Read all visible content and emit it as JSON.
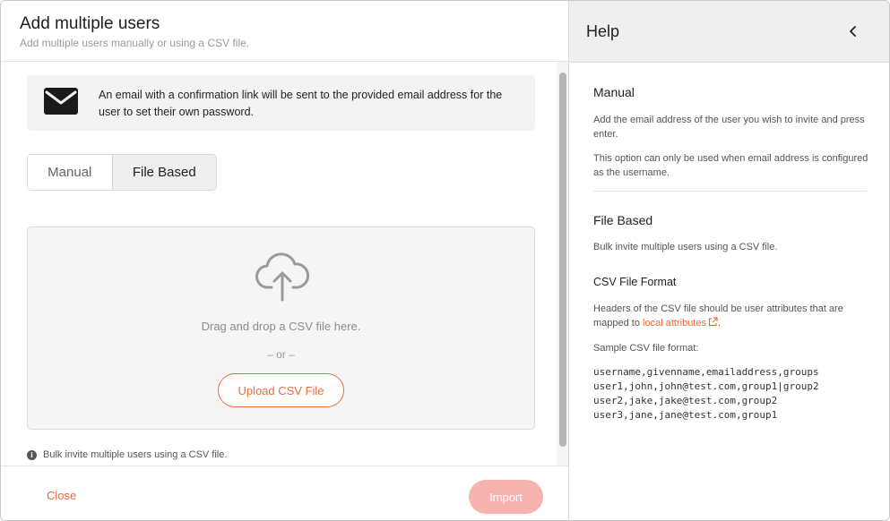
{
  "dialog": {
    "title": "Add multiple users",
    "subtitle": "Add multiple users manually or using a CSV file."
  },
  "info": {
    "icon": "mail-icon",
    "text": "An email with a confirmation link will be sent to the provided email address for the user to set their own password."
  },
  "mode_tabs": {
    "manual_label": "Manual",
    "file_label": "File Based",
    "selected": "File Based"
  },
  "dropzone": {
    "icon": "cloud-upload-icon",
    "text": "Drag and drop a CSV file here.",
    "or_text": "– or –",
    "upload_label": "Upload CSV File"
  },
  "hint": {
    "icon": "info-icon",
    "text": "Bulk invite multiple users using a CSV file."
  },
  "footer": {
    "close_label": "Close",
    "import_label": "Import"
  },
  "help": {
    "title": "Help",
    "back_icon": "chevron-left-icon",
    "manual_heading": "Manual",
    "manual_p1": "Add the email address of the user you wish to invite and press enter.",
    "manual_p2": "This option can only be used when email address is configured as the username.",
    "file_heading": "File Based",
    "file_p1": "Bulk invite multiple users using a CSV file.",
    "csv_heading": "CSV File Format",
    "csv_p_before": "Headers of the CSV file should be user attributes that are mapped to ",
    "csv_link": "local attributes",
    "csv_p_after": ".",
    "sample_label": "Sample CSV file format:",
    "sample_code": "username,givenname,emailaddress,groups\nuser1,john,john@test.com,group1|group2\nuser2,jake,jake@test.com,group2\nuser3,jane,jane@test.com,group1"
  },
  "colors": {
    "accent": "#ee6a3d",
    "import_disabled": "#f7b3ad"
  }
}
